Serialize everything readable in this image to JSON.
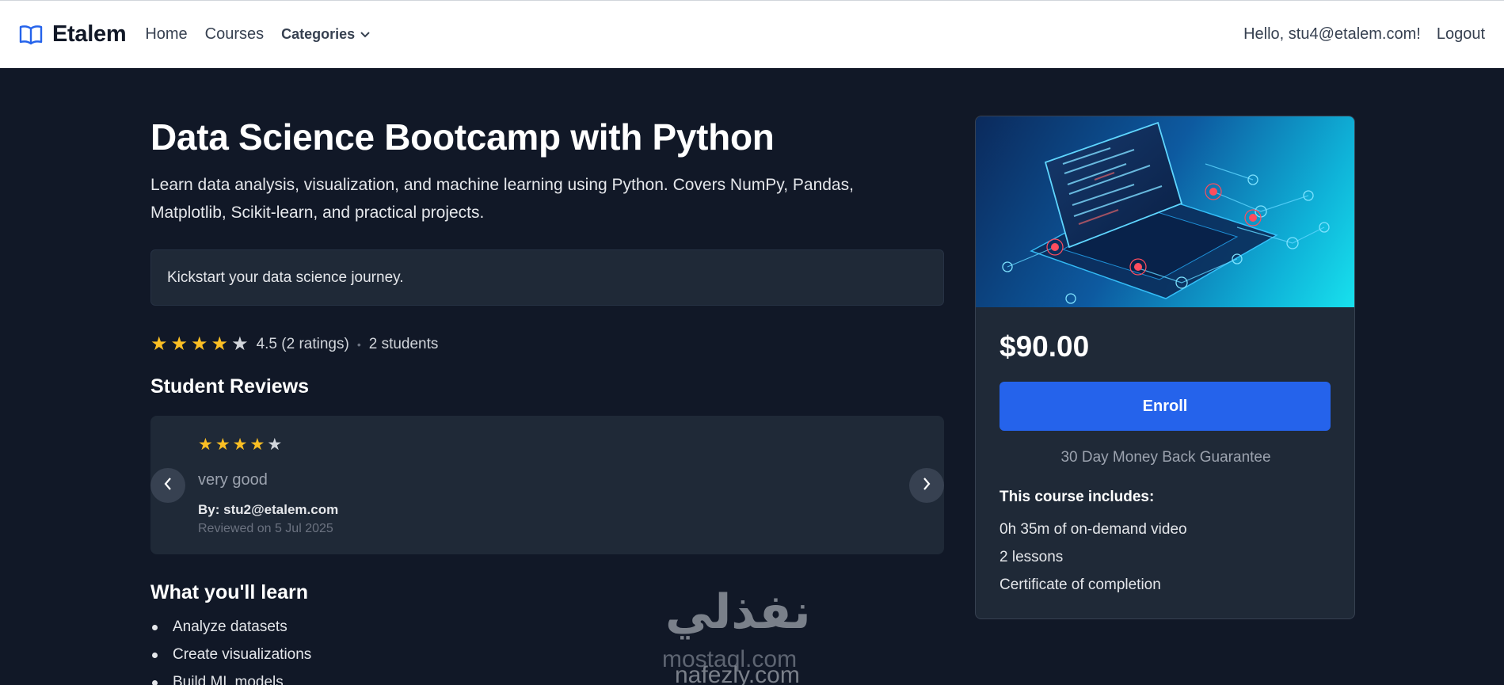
{
  "nav": {
    "brand": "Etalem",
    "links": [
      "Home",
      "Courses"
    ],
    "categories_label": "Categories",
    "greeting": "Hello, stu4@etalem.com!",
    "logout": "Logout"
  },
  "course": {
    "title": "Data Science Bootcamp with Python",
    "description": "Learn data analysis, visualization, and machine learning using Python. Covers NumPy, Pandas, Matplotlib, Scikit-learn, and practical projects.",
    "tagline": "Kickstart your data science journey.",
    "rating": {
      "stars_filled": 4,
      "stars_total": 5,
      "text": "4.5 (2 ratings)",
      "separator": "•",
      "students": "2 students"
    }
  },
  "reviews": {
    "heading": "Student Reviews",
    "current": {
      "stars_filled": 4,
      "stars_total": 5,
      "text": "very good",
      "author": "By: stu2@etalem.com",
      "date": "Reviewed on 5 Jul 2025"
    }
  },
  "learn": {
    "heading": "What you'll learn",
    "items": [
      "Analyze datasets",
      "Create visualizations",
      "Build ML models"
    ]
  },
  "sidebar": {
    "price": "$90.00",
    "enroll": "Enroll",
    "guarantee": "30 Day Money Back Guarantee",
    "includes_heading": "This course includes:",
    "includes": [
      "0h 35m of on-demand video",
      "2 lessons",
      "Certificate of completion"
    ]
  },
  "watermark": {
    "arabic": "نفذلي",
    "line1": "mostaql.com",
    "line2": "nafezly.com"
  },
  "colors": {
    "background": "#111827",
    "panel": "#1f2937",
    "accent": "#2563eb",
    "star": "#fbbf24"
  }
}
